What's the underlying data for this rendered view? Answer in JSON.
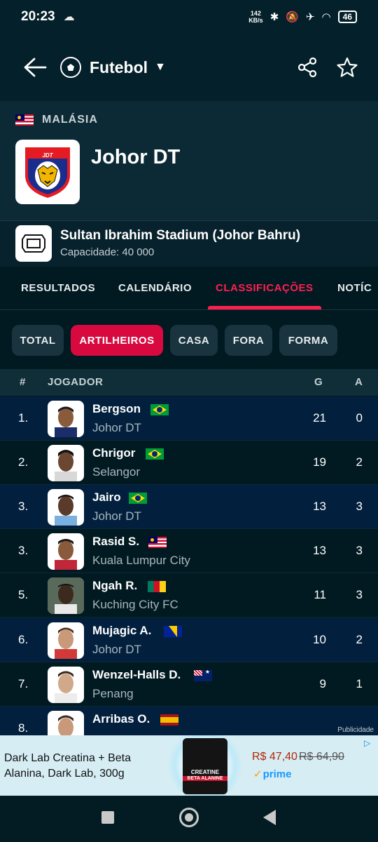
{
  "status_bar": {
    "time": "20:23",
    "speed_value": "142",
    "speed_unit": "KB/s",
    "battery": "46"
  },
  "header": {
    "sport": "Futebol",
    "icons": [
      "back-arrow-icon",
      "soccer-ball-icon",
      "caret-down-icon",
      "share-icon",
      "star-icon"
    ]
  },
  "team": {
    "country": "MALÁSIA",
    "name": "Johor DT",
    "logo_text": "JDT"
  },
  "stadium": {
    "name": "Sultan Ibrahim Stadium (Johor Bahru)",
    "capacity": "Capacidade: 40 000"
  },
  "tabs": [
    {
      "label": "RESULTADOS",
      "active": false
    },
    {
      "label": "CALENDÁRIO",
      "active": false
    },
    {
      "label": "CLASSIFICAÇÕES",
      "active": true
    },
    {
      "label": "NOTÍC",
      "active": false
    }
  ],
  "filters": [
    {
      "label": "TOTAL",
      "active": false
    },
    {
      "label": "ARTILHEIROS",
      "active": true
    },
    {
      "label": "CASA",
      "active": false
    },
    {
      "label": "FORA",
      "active": false
    },
    {
      "label": "FORMA",
      "active": false
    }
  ],
  "table": {
    "headers": {
      "rank": "#",
      "player": "JOGADOR",
      "goals": "G",
      "assists": "A"
    },
    "rows": [
      {
        "rank": "1.",
        "name": "Bergson",
        "team": "Johor DT",
        "flag": "brazil",
        "goals": "21",
        "assists": "0"
      },
      {
        "rank": "2.",
        "name": "Chrigor",
        "team": "Selangor",
        "flag": "brazil",
        "goals": "19",
        "assists": "2"
      },
      {
        "rank": "3.",
        "name": "Jairo",
        "team": "Johor DT",
        "flag": "brazil",
        "goals": "13",
        "assists": "3"
      },
      {
        "rank": "3.",
        "name": "Rasid S.",
        "team": "Kuala Lumpur City",
        "flag": "malaysia",
        "goals": "13",
        "assists": "3"
      },
      {
        "rank": "5.",
        "name": "Ngah R.",
        "team": "Kuching City FC",
        "flag": "cameroon",
        "goals": "11",
        "assists": "3"
      },
      {
        "rank": "6.",
        "name": "Mujagic A.",
        "team": "Johor DT",
        "flag": "bosnia",
        "goals": "10",
        "assists": "2"
      },
      {
        "rank": "7.",
        "name": "Wenzel-Halls D.",
        "team": "Penang",
        "flag": "australia",
        "goals": "9",
        "assists": "1"
      },
      {
        "rank": "8.",
        "name": "Arribas O.",
        "team": "",
        "flag": "spain",
        "goals": "",
        "assists": ""
      }
    ]
  },
  "ad": {
    "label": "Publicidade",
    "title": "Dark Lab Creatina + Beta Alanina, Dark Lab, 300g",
    "price": "R$ 47,40",
    "old_price": "R$ 64,90",
    "prime": "prime",
    "product_line1": "CREATINE",
    "product_line2": "BETA ALANINE"
  },
  "colors": {
    "accent": "#ff1f4f",
    "chip_active": "#d8093f",
    "highlight_row": "#02203e",
    "background": "#011a22"
  }
}
